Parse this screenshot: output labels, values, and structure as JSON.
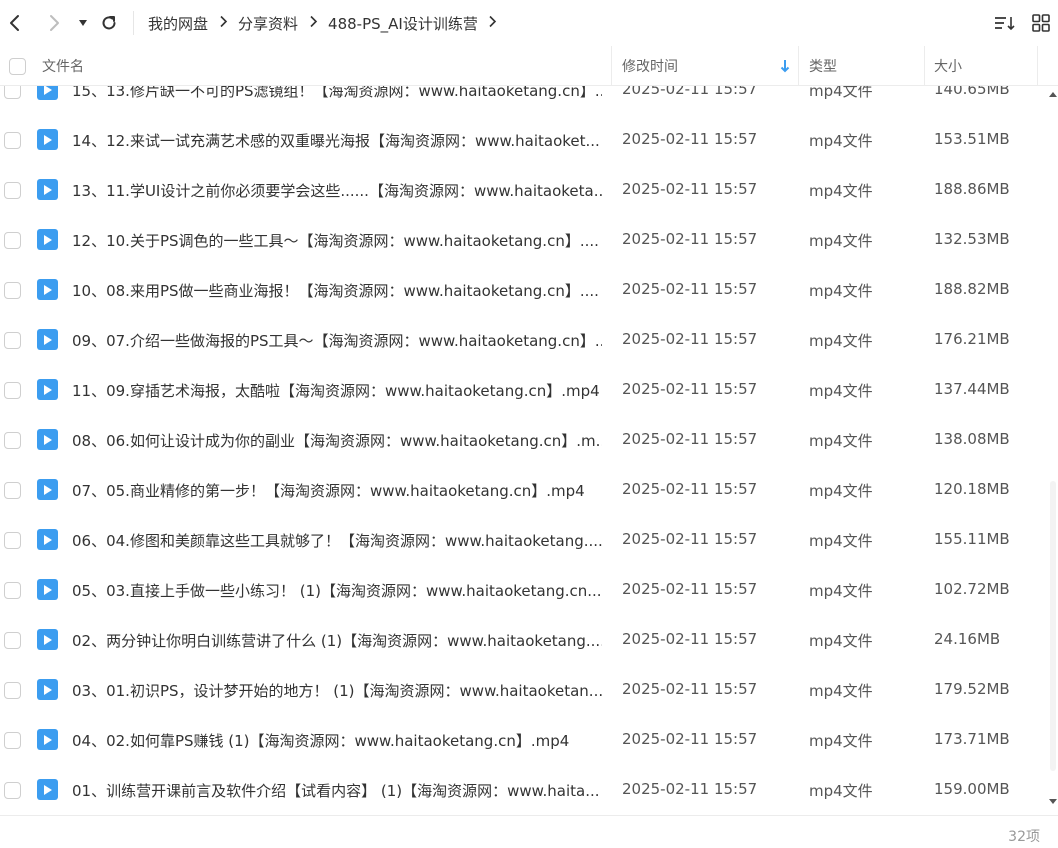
{
  "toolbar": {
    "breadcrumb": [
      "我的网盘",
      "分享资料",
      "488-PS_AI设计训练营"
    ]
  },
  "header": {
    "name_label": "文件名",
    "date_label": "修改时间",
    "type_label": "类型",
    "size_label": "大小"
  },
  "files": [
    {
      "name": "15、13.修片缺一不可的PS滤镜组！【海淘资源网：www.haitaoketang.cn】...",
      "date": "2025-02-11 15:57",
      "type": "mp4文件",
      "size": "140.65MB"
    },
    {
      "name": "14、12.来试一试充满艺术感的双重曝光海报【海淘资源网：www.haitaoket...",
      "date": "2025-02-11 15:57",
      "type": "mp4文件",
      "size": "153.51MB"
    },
    {
      "name": "13、11.学UI设计之前你必须要学会这些......【海淘资源网：www.haitaoketa...",
      "date": "2025-02-11 15:57",
      "type": "mp4文件",
      "size": "188.86MB"
    },
    {
      "name": "12、10.关于PS调色的一些工具～【海淘资源网：www.haitaoketang.cn】....",
      "date": "2025-02-11 15:57",
      "type": "mp4文件",
      "size": "132.53MB"
    },
    {
      "name": "10、08.来用PS做一些商业海报！【海淘资源网：www.haitaoketang.cn】....",
      "date": "2025-02-11 15:57",
      "type": "mp4文件",
      "size": "188.82MB"
    },
    {
      "name": "09、07.介绍一些做海报的PS工具～【海淘资源网：www.haitaoketang.cn】...",
      "date": "2025-02-11 15:57",
      "type": "mp4文件",
      "size": "176.21MB"
    },
    {
      "name": "11、09.穿插艺术海报，太酷啦【海淘资源网：www.haitaoketang.cn】.mp4",
      "date": "2025-02-11 15:57",
      "type": "mp4文件",
      "size": "137.44MB"
    },
    {
      "name": "08、06.如何让设计成为你的副业【海淘资源网：www.haitaoketang.cn】.m...",
      "date": "2025-02-11 15:57",
      "type": "mp4文件",
      "size": "138.08MB"
    },
    {
      "name": "07、05.商业精修的第一步！【海淘资源网：www.haitaoketang.cn】.mp4",
      "date": "2025-02-11 15:57",
      "type": "mp4文件",
      "size": "120.18MB"
    },
    {
      "name": "06、04.修图和美颜靠这些工具就够了！【海淘资源网：www.haitaoketang....",
      "date": "2025-02-11 15:57",
      "type": "mp4文件",
      "size": "155.11MB"
    },
    {
      "name": "05、03.直接上手做一些小练习！ (1)【海淘资源网：www.haitaoketang.cn...",
      "date": "2025-02-11 15:57",
      "type": "mp4文件",
      "size": "102.72MB"
    },
    {
      "name": "02、两分钟让你明白训练营讲了什么 (1)【海淘资源网：www.haitaoketang....",
      "date": "2025-02-11 15:57",
      "type": "mp4文件",
      "size": "24.16MB"
    },
    {
      "name": "03、01.初识PS，设计梦开始的地方！ (1)【海淘资源网：www.haitaoketan...",
      "date": "2025-02-11 15:57",
      "type": "mp4文件",
      "size": "179.52MB"
    },
    {
      "name": "04、02.如何靠PS赚钱 (1)【海淘资源网：www.haitaoketang.cn】.mp4",
      "date": "2025-02-11 15:57",
      "type": "mp4文件",
      "size": "173.71MB"
    },
    {
      "name": "01、训练营开课前言及软件介绍【试看内容】 (1)【海淘资源网：www.haita...",
      "date": "2025-02-11 15:57",
      "type": "mp4文件",
      "size": "159.00MB"
    }
  ],
  "footer": {
    "count": "32项"
  },
  "colors": {
    "accent": "#3c9df0",
    "border": "#ececec"
  },
  "icons": {
    "back": "chevron-left-icon",
    "forward": "chevron-right-icon",
    "dropdown": "caret-down-icon",
    "refresh": "refresh-icon",
    "sort": "sort-icon",
    "grid": "grid-view-icon",
    "file": "video-file-icon",
    "sort_indicator": "arrow-down-icon"
  }
}
